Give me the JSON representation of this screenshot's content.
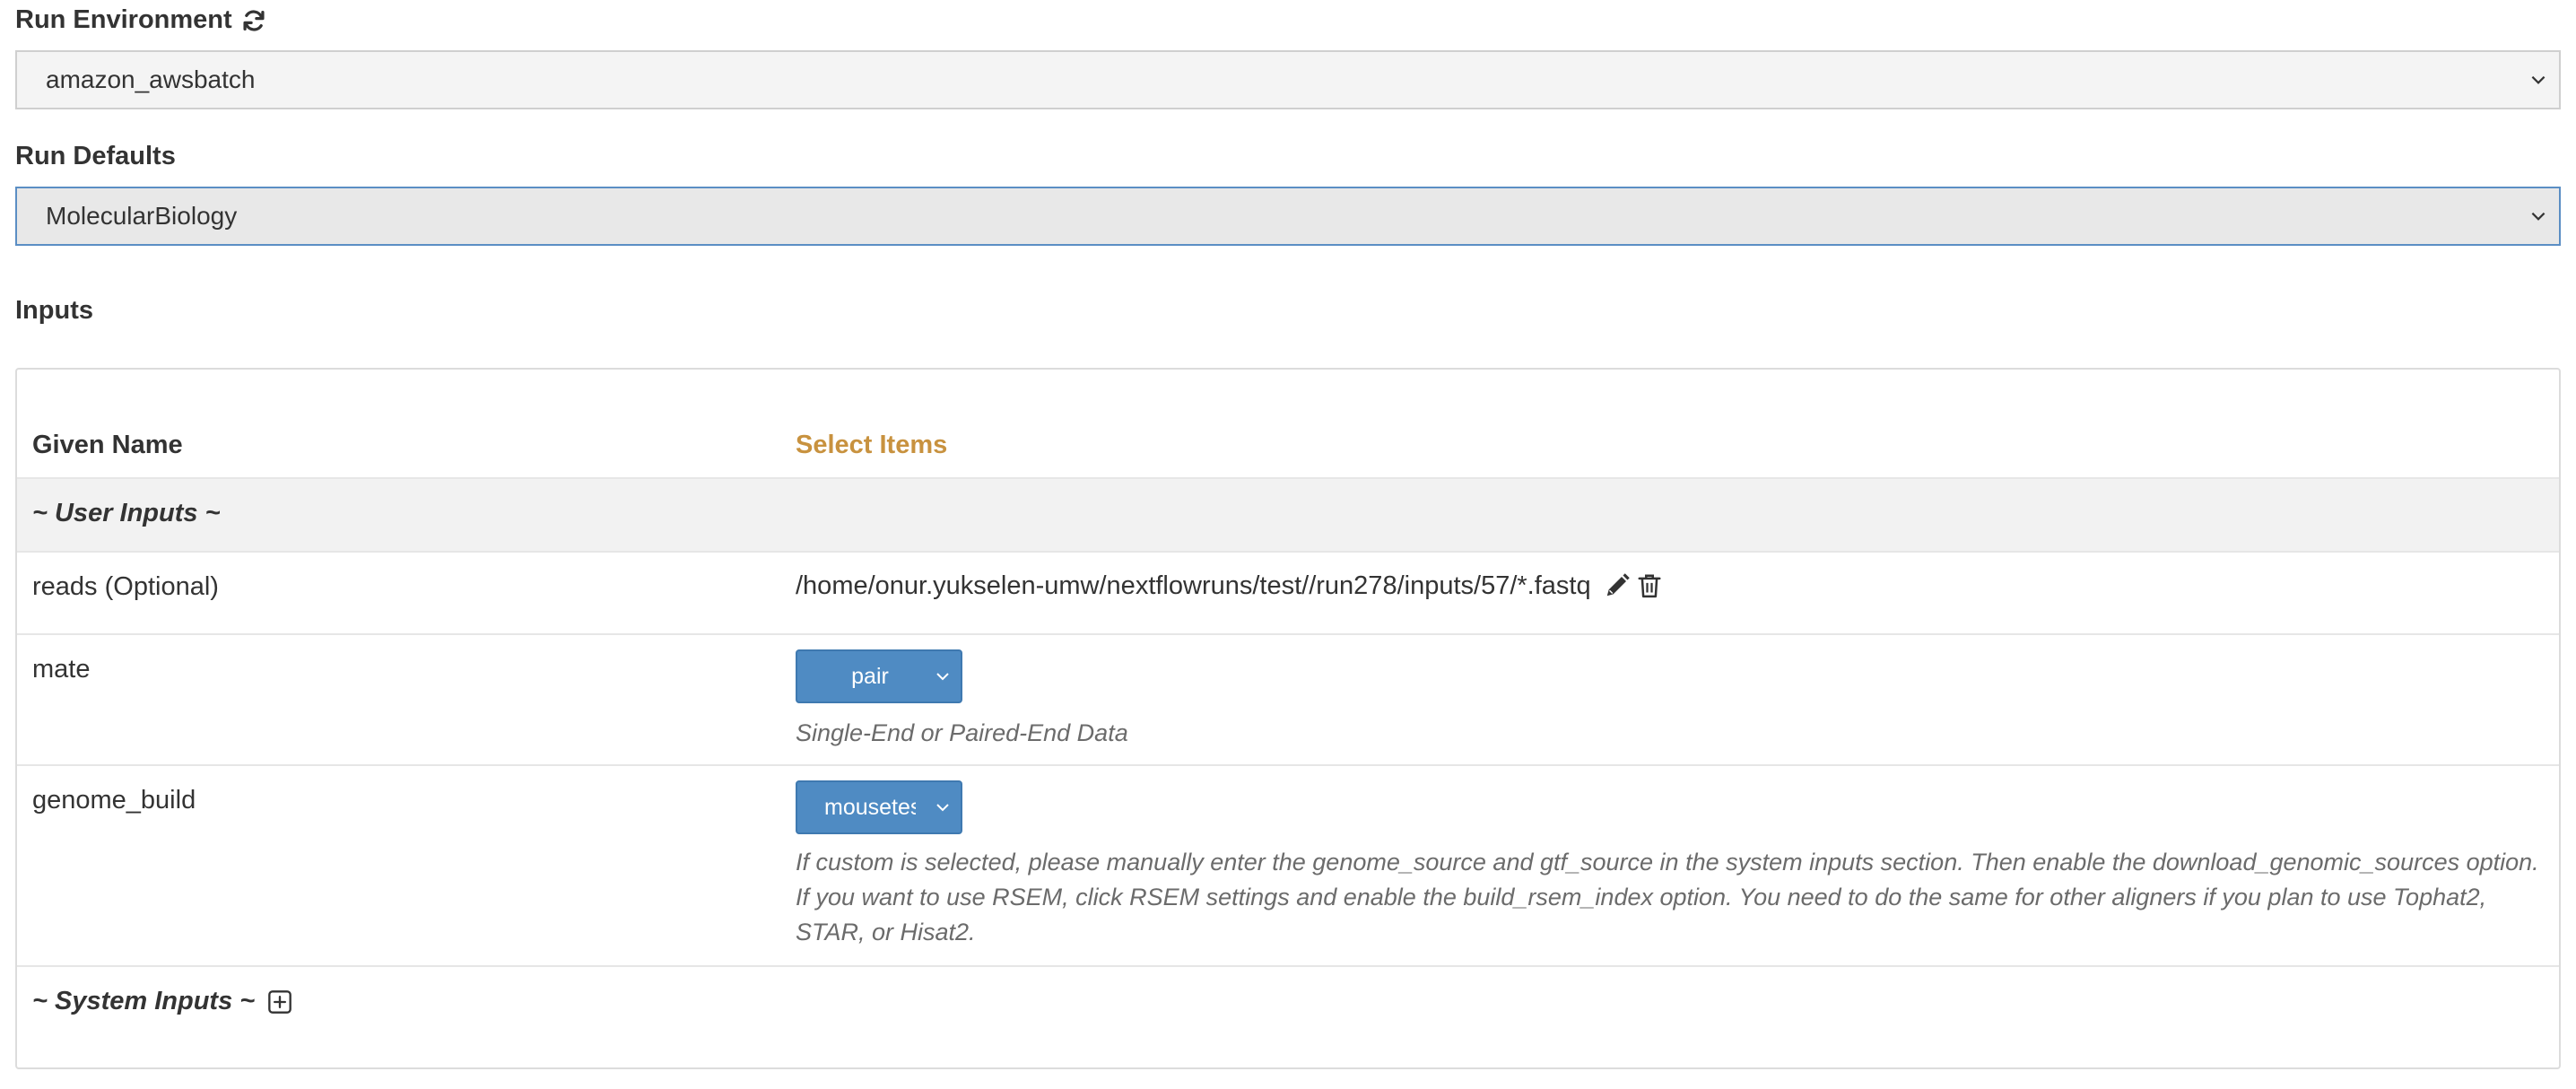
{
  "run_environment": {
    "label": "Run Environment",
    "selected": "amazon_awsbatch"
  },
  "run_defaults": {
    "label": "Run Defaults",
    "selected": "MolecularBiology"
  },
  "inputs": {
    "label": "Inputs",
    "columns": {
      "name": "Given Name",
      "value": "Select Items"
    },
    "user_group_title": "~ User Inputs ~",
    "system_group_title": "~ System Inputs ~",
    "rows": [
      {
        "name": "reads (Optional)",
        "value": "/home/onur.yukselen-umw/nextflowruns/test//run278/inputs/57/*.fastq"
      },
      {
        "name": "mate",
        "selected": "pair",
        "help": "Single-End or Paired-End Data"
      },
      {
        "name": "genome_build",
        "selected": "mousetest",
        "help": "If custom is selected, please manually enter the genome_source and gtf_source in the system inputs section. Then enable the download_genomic_sources option. If you want to use RSEM, click RSEM settings and enable the build_rsem_index option. You need to do the same for other aligners if you plan to use Tophat2, STAR, or Hisat2."
      }
    ]
  },
  "colors": {
    "accent_header": "#c8923f",
    "select_button_bg": "#4f8bc3",
    "focus_border": "#5b8ec4"
  },
  "icons": {
    "refresh": "refresh-icon",
    "edit": "pencil-icon",
    "delete": "trash-icon",
    "add": "plus-square-icon"
  }
}
